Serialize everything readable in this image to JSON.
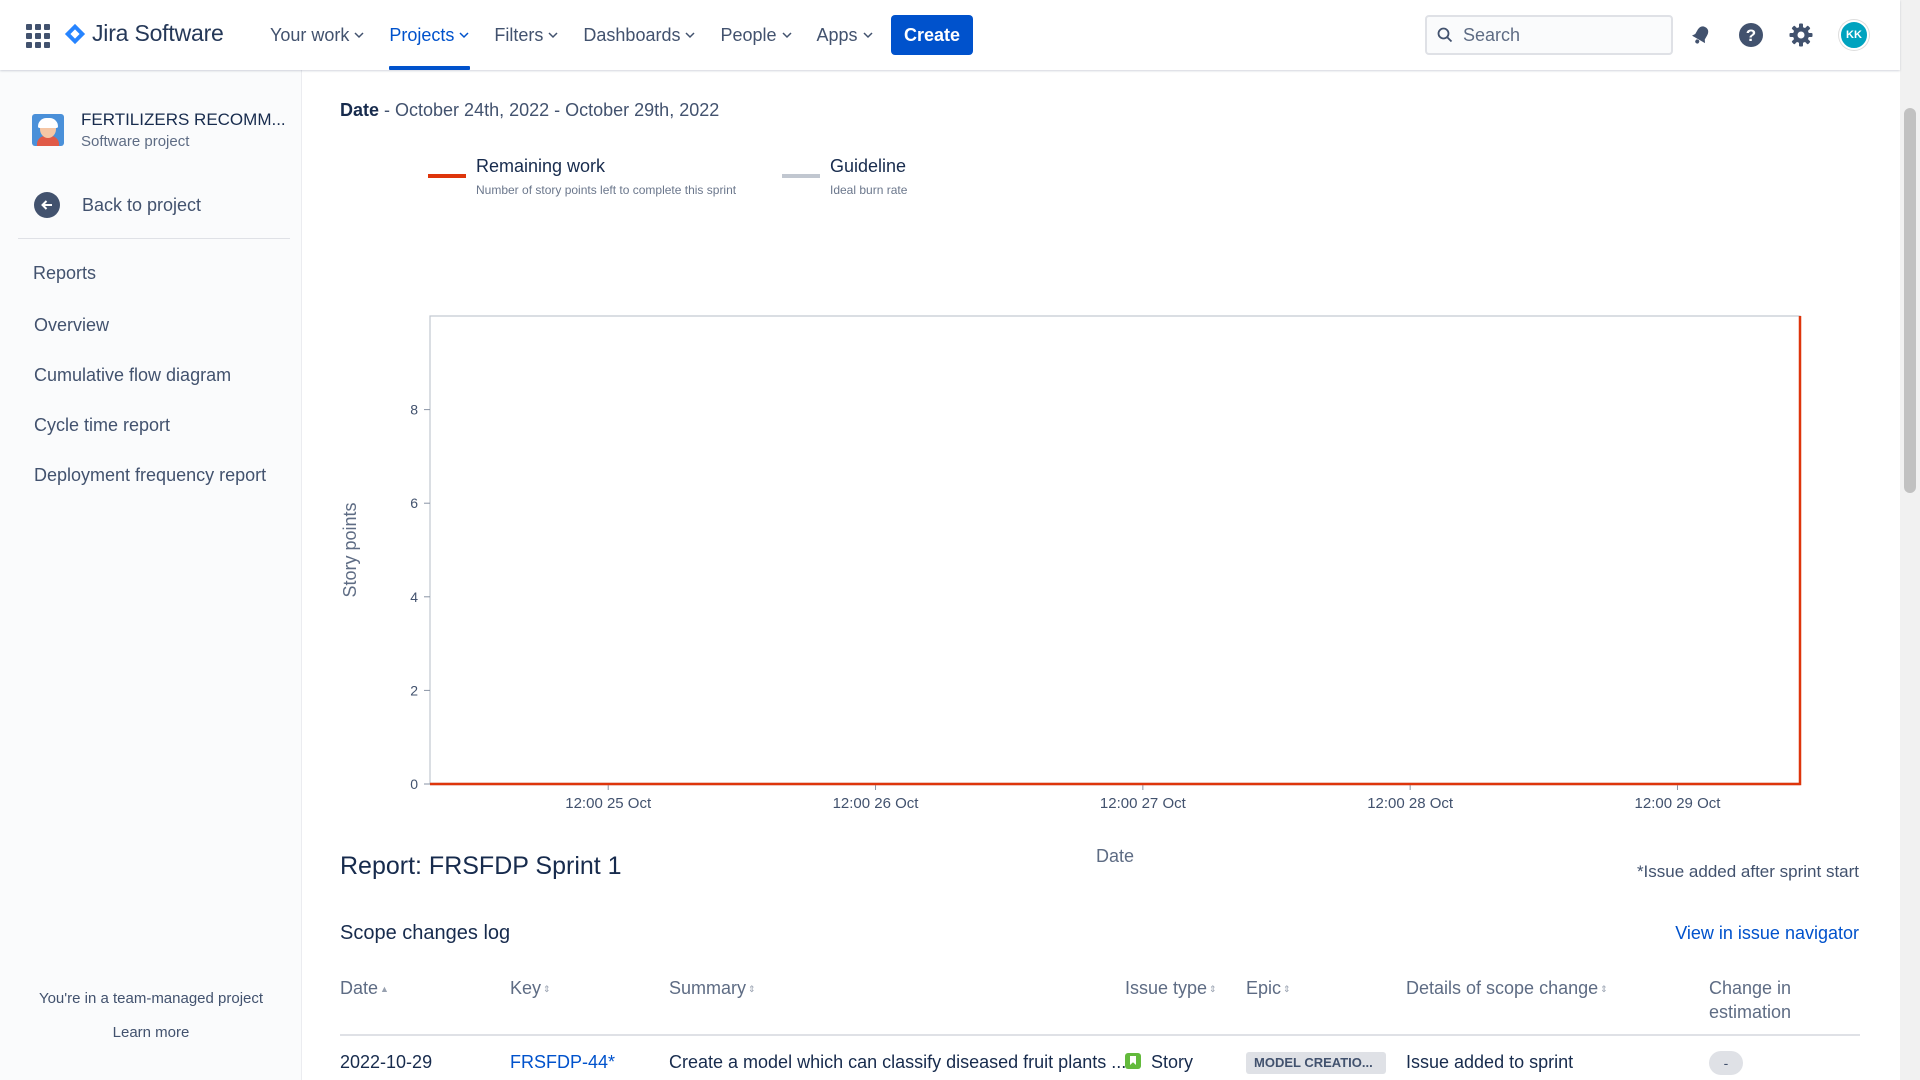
{
  "app": {
    "name": "Jira Software",
    "accent": "#0052cc"
  },
  "nav": {
    "items": [
      {
        "label": "Your work",
        "active": false
      },
      {
        "label": "Projects",
        "active": true
      },
      {
        "label": "Filters",
        "active": false
      },
      {
        "label": "Dashboards",
        "active": false
      },
      {
        "label": "People",
        "active": false
      },
      {
        "label": "Apps",
        "active": false
      }
    ],
    "create_label": "Create",
    "search_placeholder": "Search",
    "avatar_initials": "KK",
    "icons": [
      "app-switcher-icon",
      "notifications-icon",
      "help-icon",
      "settings-icon"
    ]
  },
  "sidebar": {
    "project_name": "FERTILIZERS RECOMM...",
    "project_type": "Software project",
    "back_label": "Back to project",
    "section_heading": "Reports",
    "items": [
      {
        "label": "Overview"
      },
      {
        "label": "Cumulative flow diagram"
      },
      {
        "label": "Cycle time report"
      },
      {
        "label": "Deployment frequency report"
      }
    ],
    "footer_text": "You're in a team-managed project",
    "footer_link": "Learn more"
  },
  "report": {
    "date_label": "Date",
    "date_range": "- October 24th, 2022 - October 29th, 2022",
    "legend": [
      {
        "title": "Remaining work",
        "subtitle": "Number of story points left to complete this sprint",
        "color": "#de350b"
      },
      {
        "title": "Guideline",
        "subtitle": "Ideal burn rate",
        "color": "#c1c7d0"
      }
    ],
    "title": "Report: FRSFDP Sprint 1",
    "note": "*Issue added after sprint start",
    "scope_title": "Scope changes log",
    "view_link": "View in issue navigator"
  },
  "chart_data": {
    "type": "line",
    "title": "",
    "xlabel": "Date",
    "ylabel": "Story points",
    "x_ticks": [
      "12:00 25 Oct",
      "12:00 26 Oct",
      "12:00 27 Oct",
      "12:00 28 Oct",
      "12:00 29 Oct"
    ],
    "y_ticks": [
      0,
      2,
      4,
      6,
      8
    ],
    "xlim": [
      "2022-10-24 20:00",
      "2022-10-29 23:00"
    ],
    "ylim": [
      0,
      10
    ],
    "series": [
      {
        "name": "Remaining work",
        "color": "#de350b",
        "points": [
          {
            "x": "2022-10-24 20:00",
            "y": 0
          },
          {
            "x": "2022-10-29 23:00",
            "y": 0
          },
          {
            "x": "2022-10-29 23:00",
            "y": 10
          }
        ]
      },
      {
        "name": "Guideline",
        "color": "#c1c7d0",
        "points": [
          {
            "x": "2022-10-24 20:00",
            "y": 0
          },
          {
            "x": "2022-10-29 23:00",
            "y": 0
          }
        ]
      }
    ],
    "grid": false
  },
  "table": {
    "columns": [
      "Date",
      "Key",
      "Summary",
      "Issue type",
      "Epic",
      "Details of scope change",
      "Change in estimation"
    ],
    "rows": [
      {
        "date": "2022-10-29",
        "key": "FRSFDP-44*",
        "summary": "Create a model which can classify diseased fruit plants ...",
        "issue_type": "Story",
        "epic": "MODEL CREATIO...",
        "details": "Issue added to sprint",
        "change": "-"
      }
    ]
  }
}
